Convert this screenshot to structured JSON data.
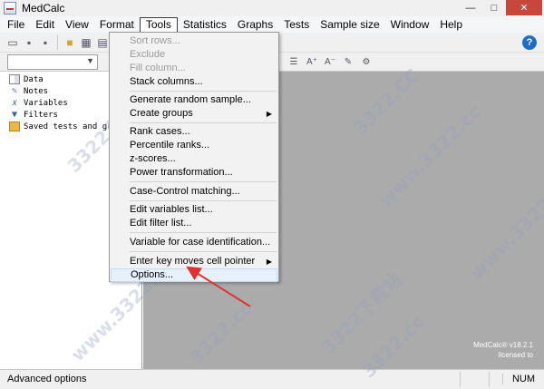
{
  "window": {
    "title": "MedCalc",
    "controls": {
      "minimize": "—",
      "maximize": "□",
      "close": "✕"
    }
  },
  "menubar": {
    "items": [
      "File",
      "Edit",
      "View",
      "Format",
      "Tools",
      "Statistics",
      "Graphs",
      "Tests",
      "Sample size",
      "Window",
      "Help"
    ],
    "active": "Tools"
  },
  "toolbar": {
    "help": "?",
    "text_icons": [
      "A⁺",
      "A⁻"
    ]
  },
  "tree": {
    "items": [
      "Data",
      "Notes",
      "Variables",
      "Filters",
      "Saved tests and graphs"
    ]
  },
  "tools_menu": {
    "items": [
      {
        "label": "Sort rows...",
        "disabled": true
      },
      {
        "label": "Exclude",
        "disabled": true
      },
      {
        "label": "Fill column...",
        "disabled": true
      },
      {
        "label": "Stack columns..."
      },
      {
        "label": "Generate random sample..."
      },
      {
        "label": "Create groups",
        "submenu": true
      },
      {
        "label": "Rank cases..."
      },
      {
        "label": "Percentile ranks..."
      },
      {
        "label": "z-scores..."
      },
      {
        "label": "Power transformation..."
      },
      {
        "label": "Case-Control matching..."
      },
      {
        "label": "Edit variables list..."
      },
      {
        "label": "Edit filter list..."
      },
      {
        "label": "Variable for case identification..."
      },
      {
        "label": "Enter key moves cell pointer",
        "submenu": true
      },
      {
        "label": "Options...",
        "highlighted": true
      }
    ]
  },
  "workspace": {
    "version_line1": "MedCalc® v18.2.1",
    "version_line2": "licensed to"
  },
  "statusbar": {
    "left": "Advanced options",
    "num": "NUM"
  },
  "watermarks": [
    "3322.CC",
    "www.3322.cc",
    "3322下载站",
    "www.3322.cc",
    "3322.cc",
    "www.3322.cc",
    "3322下载站",
    "3322.cc"
  ],
  "annotation": {
    "arrow_color": "#e03030"
  }
}
